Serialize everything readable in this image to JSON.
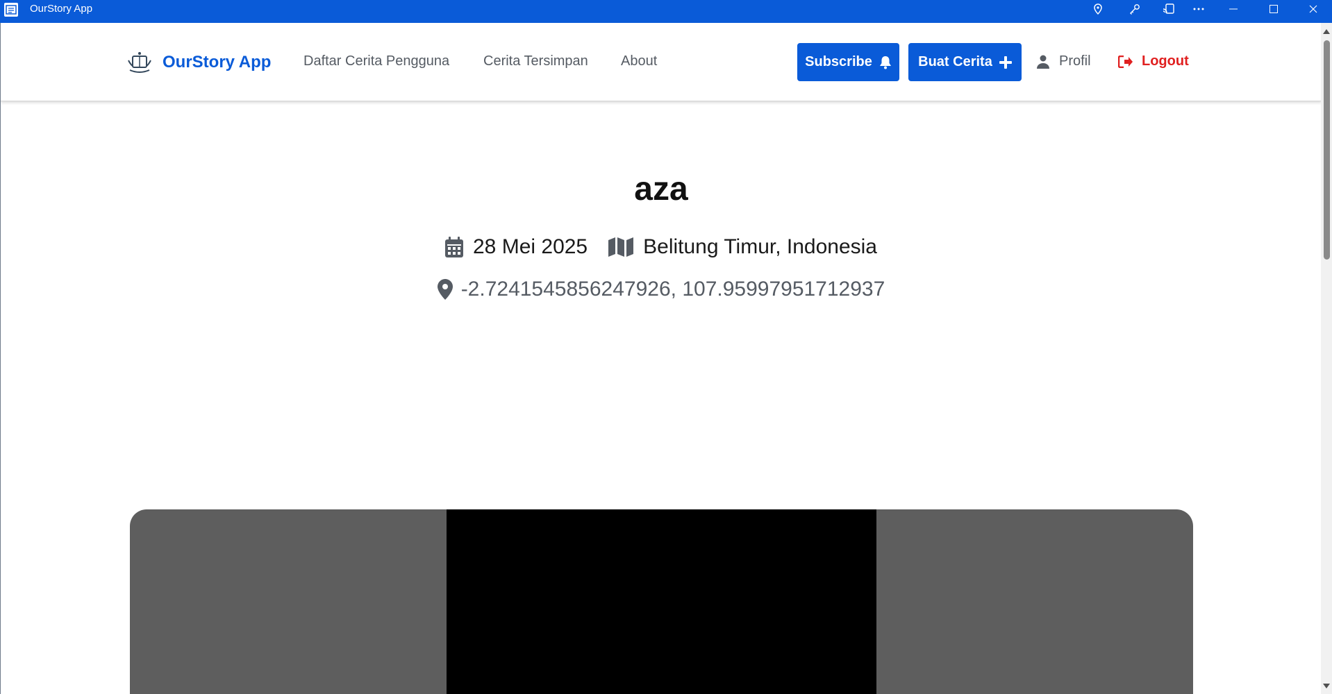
{
  "window": {
    "title": "OurStory App",
    "icons": [
      "location-pin-icon",
      "key-icon",
      "cast-icon",
      "more-icon",
      "minimize-icon",
      "maximize-icon",
      "close-icon"
    ]
  },
  "header": {
    "brand_name": "OurStory App",
    "nav": {
      "daftar": "Daftar Cerita Pengguna",
      "tersimpan": "Cerita Tersimpan",
      "about": "About"
    },
    "subscribe_label": "Subscribe",
    "buat_label": "Buat Cerita",
    "profile_label": "Profil",
    "logout_label": "Logout"
  },
  "story": {
    "title": "aza",
    "date": "28 Mei 2025",
    "location": "Belitung Timur, Indonesia",
    "coordinates": "-2.7241545856247926, 107.95997951712937"
  },
  "colors": {
    "accent": "#0a5bd8",
    "logout": "#e02020",
    "muted_text": "#555b63",
    "media_frame": "#5e5e5e"
  }
}
